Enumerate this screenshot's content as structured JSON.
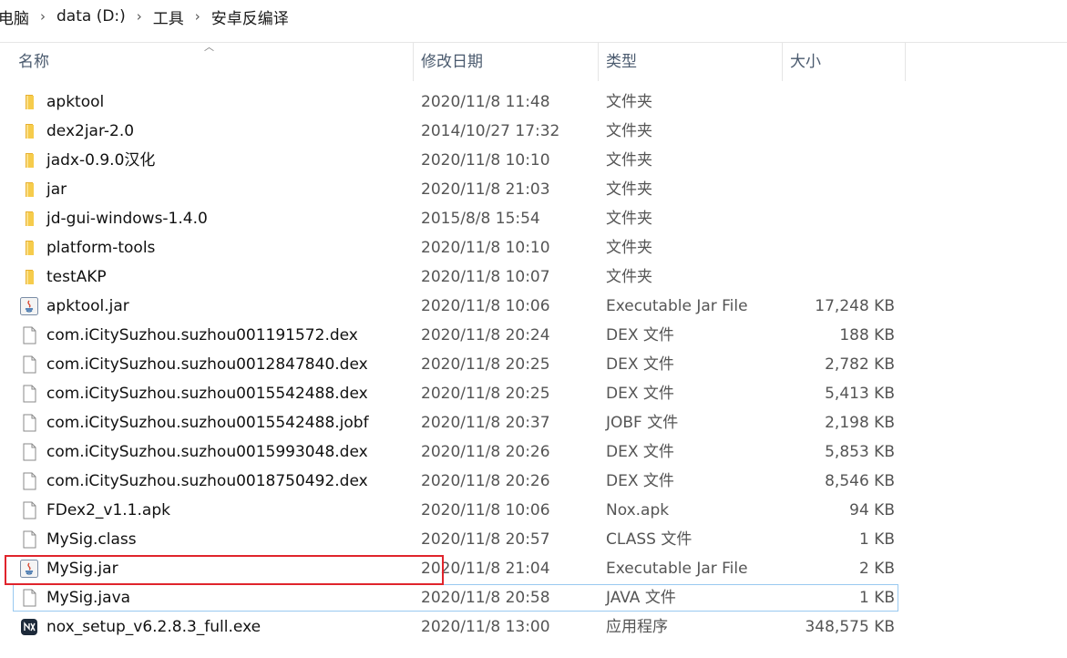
{
  "breadcrumb": [
    "电脑",
    "data (D:)",
    "工具",
    "安卓反编译"
  ],
  "breadcrumb_separator": "›",
  "columns": {
    "name": "名称",
    "date": "修改日期",
    "type": "类型",
    "size": "大小"
  },
  "rows": [
    {
      "icon": "folder",
      "name": "apktool",
      "date": "2020/11/8 11:48",
      "type": "文件夹",
      "size": ""
    },
    {
      "icon": "folder",
      "name": "dex2jar-2.0",
      "date": "2014/10/27 17:32",
      "type": "文件夹",
      "size": ""
    },
    {
      "icon": "folder",
      "name": "jadx-0.9.0汉化",
      "date": "2020/11/8 10:10",
      "type": "文件夹",
      "size": ""
    },
    {
      "icon": "folder",
      "name": "jar",
      "date": "2020/11/8 21:03",
      "type": "文件夹",
      "size": ""
    },
    {
      "icon": "folder",
      "name": "jd-gui-windows-1.4.0",
      "date": "2015/8/8 15:54",
      "type": "文件夹",
      "size": ""
    },
    {
      "icon": "folder",
      "name": "platform-tools",
      "date": "2020/11/8 10:10",
      "type": "文件夹",
      "size": ""
    },
    {
      "icon": "folder",
      "name": "testAKP",
      "date": "2020/11/8 10:07",
      "type": "文件夹",
      "size": ""
    },
    {
      "icon": "jar",
      "name": "apktool.jar",
      "date": "2020/11/8 10:06",
      "type": "Executable Jar File",
      "size": "17,248 KB"
    },
    {
      "icon": "file",
      "name": "com.iCitySuzhou.suzhou001191572.dex",
      "date": "2020/11/8 20:24",
      "type": "DEX 文件",
      "size": "188 KB"
    },
    {
      "icon": "file",
      "name": "com.iCitySuzhou.suzhou0012847840.dex",
      "date": "2020/11/8 20:25",
      "type": "DEX 文件",
      "size": "2,782 KB"
    },
    {
      "icon": "file",
      "name": "com.iCitySuzhou.suzhou0015542488.dex",
      "date": "2020/11/8 20:25",
      "type": "DEX 文件",
      "size": "5,413 KB"
    },
    {
      "icon": "file",
      "name": "com.iCitySuzhou.suzhou0015542488.jobf",
      "date": "2020/11/8 20:37",
      "type": "JOBF 文件",
      "size": "2,198 KB"
    },
    {
      "icon": "file",
      "name": "com.iCitySuzhou.suzhou0015993048.dex",
      "date": "2020/11/8 20:26",
      "type": "DEX 文件",
      "size": "5,853 KB"
    },
    {
      "icon": "file",
      "name": "com.iCitySuzhou.suzhou0018750492.dex",
      "date": "2020/11/8 20:26",
      "type": "DEX 文件",
      "size": "8,546 KB"
    },
    {
      "icon": "file",
      "name": "FDex2_v1.1.apk",
      "date": "2020/11/8 10:06",
      "type": "Nox.apk",
      "size": "94 KB"
    },
    {
      "icon": "file",
      "name": "MySig.class",
      "date": "2020/11/8 20:57",
      "type": "CLASS 文件",
      "size": "1 KB"
    },
    {
      "icon": "jar",
      "name": "MySig.jar",
      "date": "2020/11/8 21:04",
      "type": "Executable Jar File",
      "size": "2 KB"
    },
    {
      "icon": "file",
      "name": "MySig.java",
      "date": "2020/11/8 20:58",
      "type": "JAVA 文件",
      "size": "1 KB"
    },
    {
      "icon": "exe",
      "name": "nox_setup_v6.2.8.3_full.exe",
      "date": "2020/11/8 13:00",
      "type": "应用程序",
      "size": "348,575 KB"
    }
  ],
  "colors": {
    "highlight": "#e0242c",
    "hover": "#99c9f0",
    "folder": "#f4c242"
  }
}
